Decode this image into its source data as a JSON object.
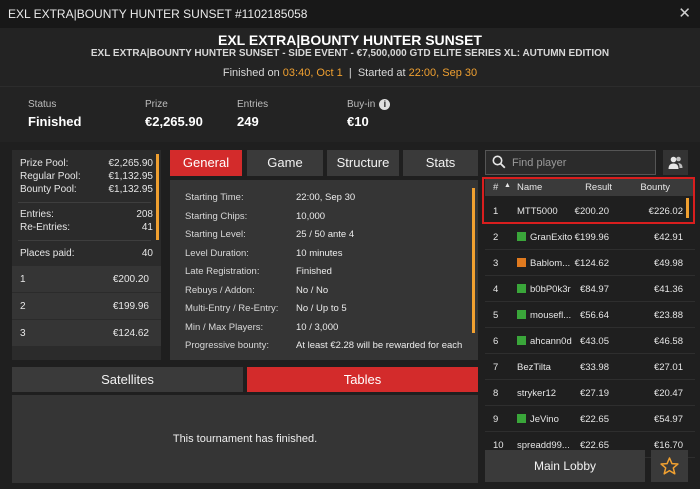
{
  "window": {
    "title": "EXL EXTRA|BOUNTY HUNTER SUNSET #1102185058",
    "close_glyph": "✕"
  },
  "header": {
    "title": "EXL EXTRA|BOUNTY HUNTER SUNSET",
    "subtitle": "EXL EXTRA|BOUNTY HUNTER SUNSET - SIDE EVENT - €7,500,000 GTD ELITE SERIES XL: AUTUMN EDITION",
    "finished_label": "Finished on",
    "finished_value": "03:40, Oct 1",
    "started_label": "Started at",
    "started_value": "22:00, Sep 30",
    "separator": "|"
  },
  "stats": {
    "status_label": "Status",
    "status_value": "Finished",
    "prize_label": "Prize",
    "prize_value": "€2,265.90",
    "entries_label": "Entries",
    "entries_value": "249",
    "buyin_label": "Buy-in",
    "buyin_value": "€10"
  },
  "prize_pool": {
    "rows": [
      {
        "label": "Prize Pool:",
        "value": "€2,265.90"
      },
      {
        "label": "Regular Pool:",
        "value": "€1,132.95"
      },
      {
        "label": "Bounty Pool:",
        "value": "€1,132.95"
      },
      {
        "label": "Entries:",
        "value": "208"
      },
      {
        "label": "Re-Entries:",
        "value": "41"
      },
      {
        "label": "Places paid:",
        "value": "40"
      }
    ],
    "places": [
      {
        "place": "1",
        "amount": "€200.20"
      },
      {
        "place": "2",
        "amount": "€199.96"
      },
      {
        "place": "3",
        "amount": "€124.62"
      }
    ]
  },
  "tabs": {
    "general": "General",
    "game": "Game",
    "structure": "Structure",
    "stats": "Stats",
    "active": "General"
  },
  "details": [
    {
      "label": "Starting Time:",
      "value": "22:00, Sep 30"
    },
    {
      "label": "Starting Chips:",
      "value": "10,000"
    },
    {
      "label": "Starting Level:",
      "value": "25 / 50 ante 4"
    },
    {
      "label": "Level Duration:",
      "value": "10 minutes"
    },
    {
      "label": "Late Registration:",
      "value": "Finished"
    },
    {
      "label": "Rebuys / Addon:",
      "value": "No / No"
    },
    {
      "label": "Multi-Entry / Re-Entry:",
      "value": "No / Up to 5"
    },
    {
      "label": "Min / Max Players:",
      "value": "10 / 3,000"
    },
    {
      "label": "Progressive bounty:",
      "value": "At least €2.28 will be rewarded for each"
    }
  ],
  "bottom_tabs": {
    "satellites": "Satellites",
    "tables": "Tables",
    "active": "Tables"
  },
  "finished_message": "This tournament has finished.",
  "search": {
    "placeholder": "Find player"
  },
  "results": {
    "headers": {
      "rank": "#",
      "sort": "▲",
      "name": "Name",
      "result": "Result",
      "bounty": "Bounty"
    },
    "rows": [
      {
        "rank": "1",
        "flag": "",
        "name": "MTT5000",
        "result": "€200.20",
        "bounty": "€226.02"
      },
      {
        "rank": "2",
        "flag": "#3aa63a",
        "name": "GranExito",
        "result": "€199.96",
        "bounty": "€42.91"
      },
      {
        "rank": "3",
        "flag": "#e07a1f",
        "name": "Bablom...",
        "result": "€124.62",
        "bounty": "€49.98"
      },
      {
        "rank": "4",
        "flag": "#3aa63a",
        "name": "b0bP0k3r",
        "result": "€84.97",
        "bounty": "€41.36"
      },
      {
        "rank": "5",
        "flag": "#3aa63a",
        "name": "mousefl...",
        "result": "€56.64",
        "bounty": "€23.88"
      },
      {
        "rank": "6",
        "flag": "#3aa63a",
        "name": "ahcann0d",
        "result": "€43.05",
        "bounty": "€46.58"
      },
      {
        "rank": "7",
        "flag": "",
        "name": "BezTilta",
        "result": "€33.98",
        "bounty": "€27.01"
      },
      {
        "rank": "8",
        "flag": "",
        "name": "stryker12",
        "result": "€27.19",
        "bounty": "€20.47"
      },
      {
        "rank": "9",
        "flag": "#3aa63a",
        "name": "JeVino",
        "result": "€22.65",
        "bounty": "€54.97"
      },
      {
        "rank": "10",
        "flag": "",
        "name": "spreadd99...",
        "result": "€22.65",
        "bounty": "€16.70"
      }
    ]
  },
  "main_lobby": "Main Lobby",
  "colors": {
    "accent_red": "#d32b2b",
    "accent_orange": "#f0a030",
    "flag_green": "#3aa63a",
    "flag_orange": "#e07a1f"
  },
  "icons": [
    "close-icon",
    "info-icon",
    "search-icon",
    "users-icon",
    "star-icon",
    "sort-ascending-icon"
  ]
}
